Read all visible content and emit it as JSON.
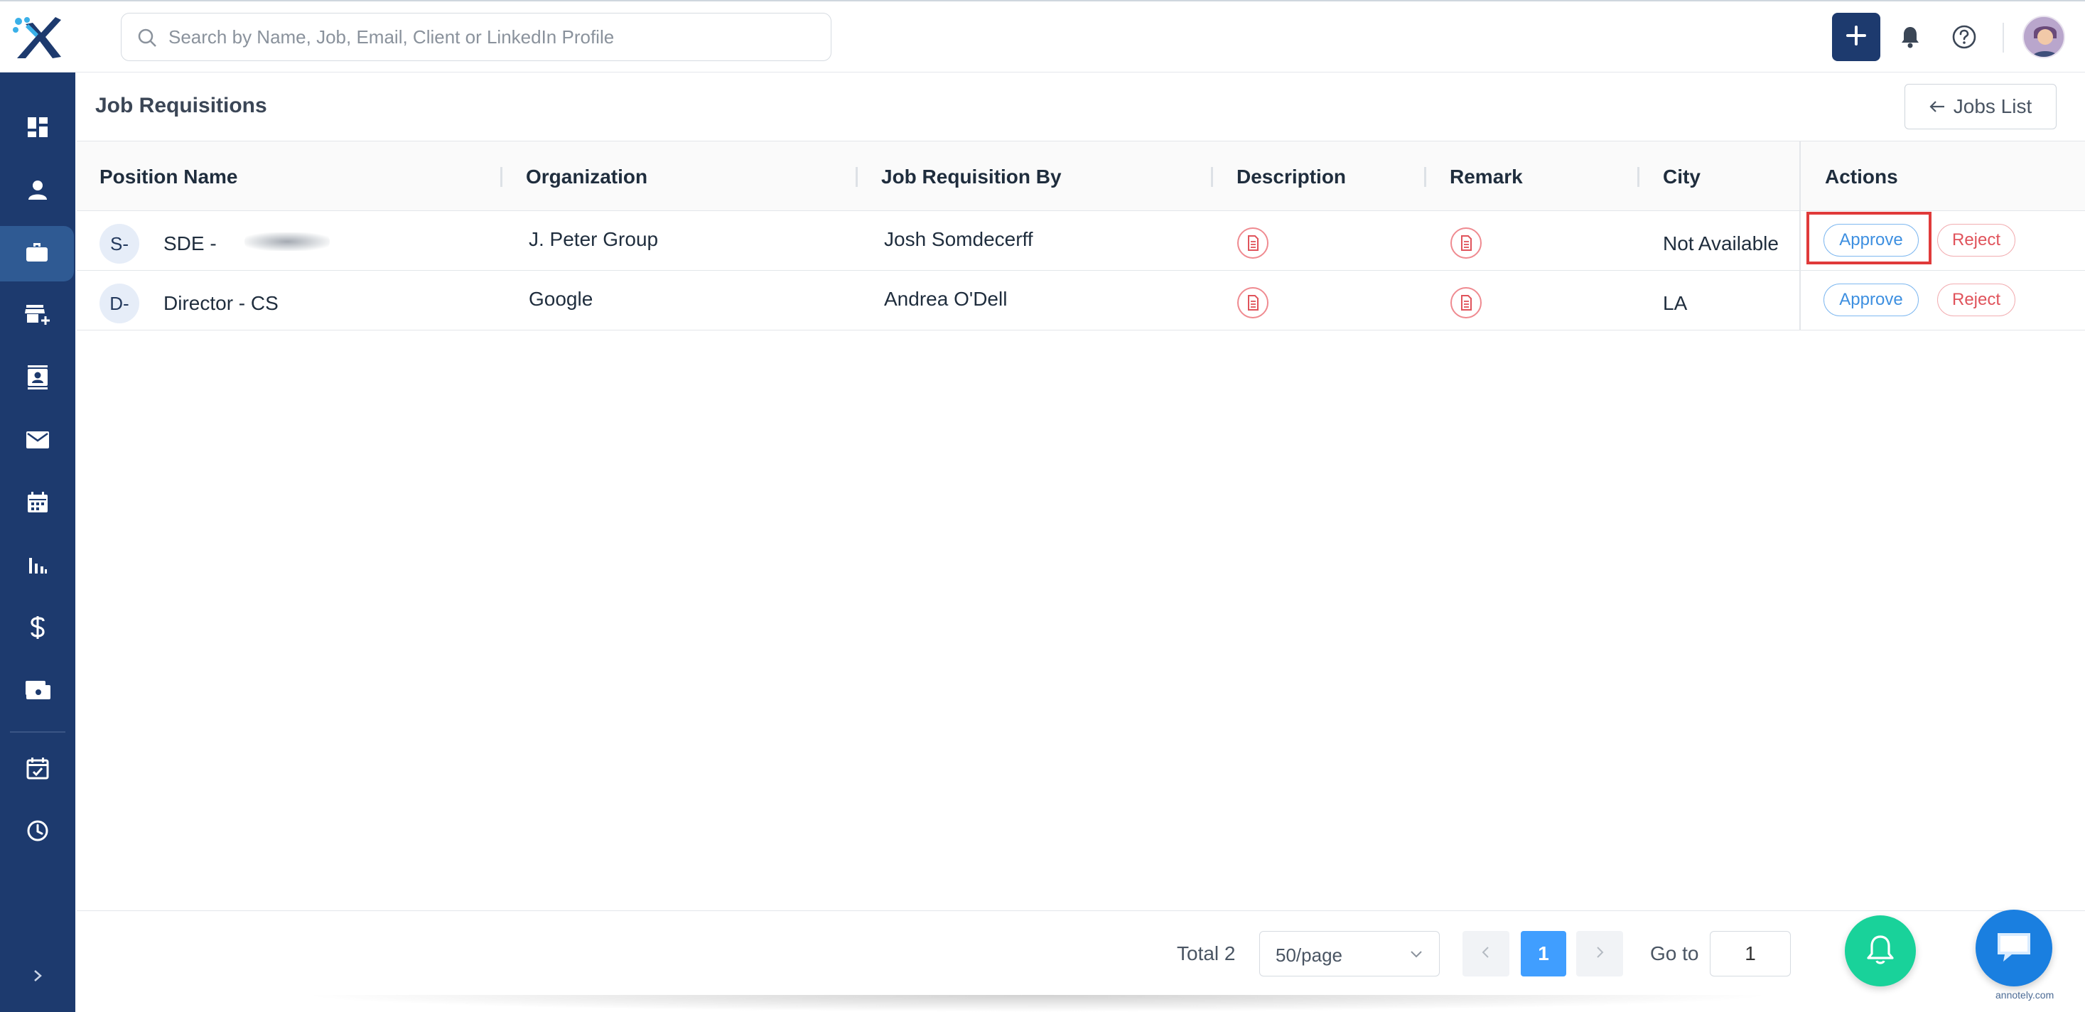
{
  "search": {
    "placeholder": "Search by Name, Job, Email, Client or LinkedIn Profile"
  },
  "icons": {
    "logo": "app-logo",
    "search": "search-icon",
    "add": "plus-icon",
    "bell": "bell-icon",
    "help": "question-circle-icon",
    "sidebar": [
      "dashboard-icon",
      "person-icon",
      "briefcase-icon",
      "store-add-icon",
      "contact-card-icon",
      "mail-icon",
      "calendar-icon",
      "bar-chart-icon",
      "dollar-icon",
      "money-icon",
      "calendar-check-icon",
      "clock-icon",
      "chevron-right-icon"
    ]
  },
  "colors": {
    "sidebar": "#1d3a6e",
    "sidebar_active": "#2f5a93",
    "approve": "#3d8fe0",
    "reject": "#e0535b",
    "page_current": "#409eff",
    "fab_bell": "#19d29a",
    "fab_chat": "#1a7fe0",
    "highlight": "#e03a3a"
  },
  "page": {
    "title": "Job Requisitions",
    "jobs_list_label": "Jobs List"
  },
  "table": {
    "columns": [
      "Position Name",
      "Organization",
      "Job Requisition By",
      "Description",
      "Remark",
      "City",
      "Actions"
    ],
    "rows": [
      {
        "badge": "S-",
        "position": "SDE -",
        "organization": "J. Peter Group",
        "requested_by": "Josh Somdecerff",
        "city": "Not Available",
        "approve": "Approve",
        "reject": "Reject"
      },
      {
        "badge": "D-",
        "position": "Director - CS",
        "organization": "Google",
        "requested_by": "Andrea O'Dell",
        "city": "LA",
        "approve": "Approve",
        "reject": "Reject"
      }
    ]
  },
  "pagination": {
    "total_label": "Total 2",
    "page_size": "50/page",
    "current_page": "1",
    "goto_label": "Go to",
    "goto_value": "1"
  },
  "watermark": "annotely.com"
}
